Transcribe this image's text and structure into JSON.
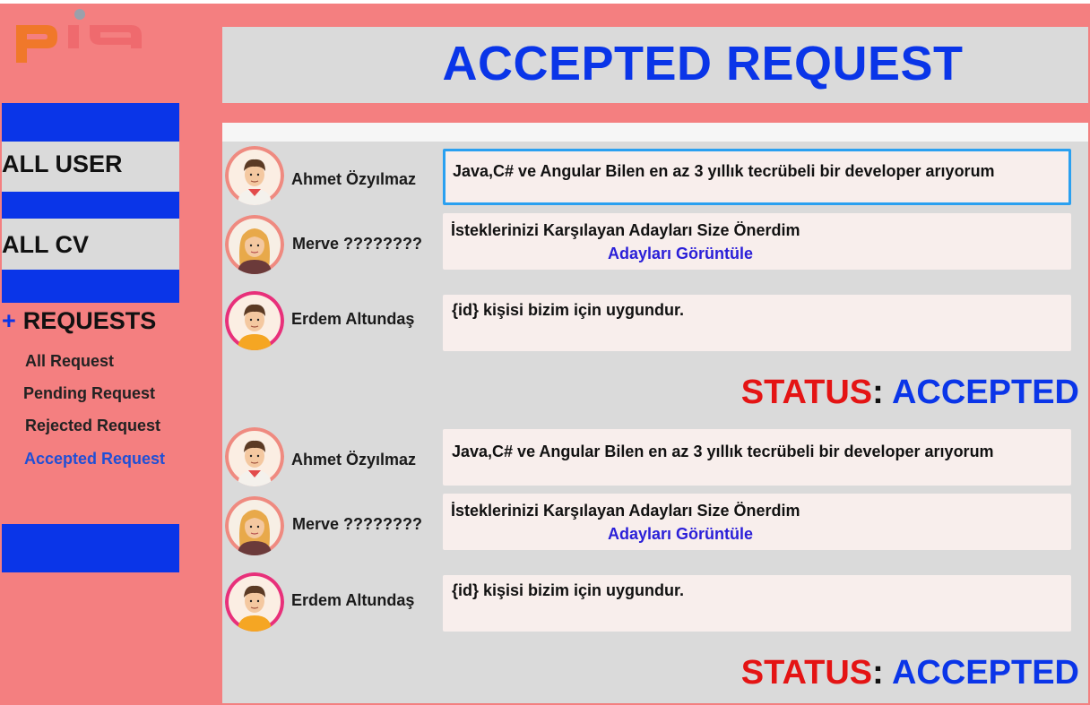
{
  "logo": {
    "text": "pia",
    "colors": {
      "p": "#f0782a",
      "ia": "#ef6a6e",
      "dot": "#9aa0ab"
    }
  },
  "sidebar": {
    "all_user": "ALL USER",
    "all_cv": "ALL CV",
    "requests_toggle": "+",
    "requests": "REQUESTS",
    "items": [
      {
        "label": "All Request"
      },
      {
        "label": "Pending Request"
      },
      {
        "label": "Rejected Request"
      },
      {
        "label": "Accepted Request",
        "active": true
      }
    ]
  },
  "page": {
    "title": "ACCEPTED REQUEST"
  },
  "groups": [
    {
      "messages": [
        {
          "user": "Ahmet Özyılmaz",
          "avatar": "male-avatar-icon",
          "text": "Java,C# ve Angular Bilen en az 3 yıllık tecrübeli bir developer arıyorum"
        },
        {
          "user": "Merve ????????",
          "avatar": "female-avatar-icon",
          "text": "İsteklerinizi Karşılayan Adayları Size Önerdim",
          "link": "Adayları Görüntüle"
        },
        {
          "user": "Erdem Altundaş",
          "avatar": "male-avatar-icon",
          "text": "{id} kişisi bizim için uygundur."
        }
      ],
      "status": {
        "label": "STATUS",
        "sep": ":",
        "value": "ACCEPTED"
      }
    },
    {
      "messages": [
        {
          "user": "Ahmet Özyılmaz",
          "avatar": "male-avatar-icon",
          "text": "Java,C# ve Angular Bilen en az 3 yıllık tecrübeli bir developer arıyorum"
        },
        {
          "user": "Merve ????????",
          "avatar": "female-avatar-icon",
          "text": "İsteklerinizi Karşılayan Adayları Size Önerdim",
          "link": "Adayları Görüntüle"
        },
        {
          "user": "Erdem Altundaş",
          "avatar": "male-avatar-icon",
          "text": "{id} kişisi bizim için uygundur."
        }
      ],
      "status": {
        "label": "STATUS",
        "sep": ":",
        "value": "ACCEPTED"
      }
    }
  ],
  "colors": {
    "frame": "#f47f80",
    "accent_blue": "#0a35e8",
    "panel": "#dadada",
    "bubble": "#f8eeec",
    "status_red": "#e41414",
    "link": "#2a1fd8"
  }
}
